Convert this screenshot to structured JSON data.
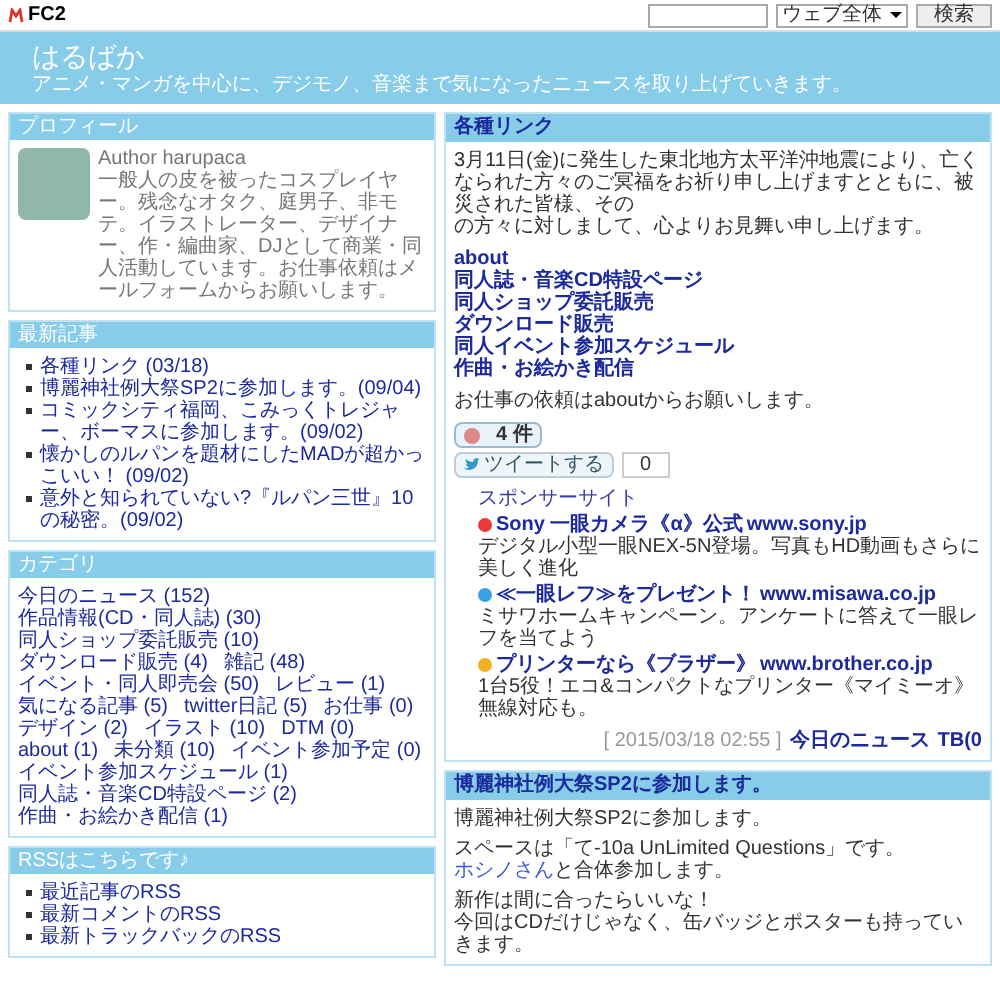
{
  "topbar": {
    "logo": "FC2",
    "search_scope": "ウェブ全体",
    "search_button": "検索"
  },
  "header": {
    "title": "はるばか",
    "tagline": "アニメ・マンガを中心に、デジモノ、音楽まで気になったニュースを取り上げていきます。"
  },
  "sidebar": {
    "profile": {
      "title": "プロフィール",
      "author": "Author harupaca",
      "bio": "一般人の皮を被ったコスプレイヤー。残念なオタク、庭男子、非モテ。イラストレーター、デザイナー、作・編曲家、DJとして商業・同人活動しています。お仕事依頼はメールフォームからお願いします。"
    },
    "latest": {
      "title": "最新記事",
      "items": [
        "各種リンク (03/18)",
        "博麗神社例大祭SP2に参加します。(09/04)",
        "コミックシティ福岡、こみっくトレジャー、ボーマスに参加します。(09/02)",
        "懐かしのルパンを題材にしたMADが超かっこいい！ (09/02)",
        "意外と知られていない?『ルパン三世』10の秘密。(09/02)"
      ]
    },
    "categories": {
      "title": "カテゴリ",
      "items": [
        "今日のニュース (152)",
        "作品情報(CD・同人誌) (30)",
        "同人ショップ委託販売 (10)",
        "ダウンロード販売 (4)",
        "雑記 (48)",
        "イベント・同人即売会 (50)",
        "レビュー (1)",
        "気になる記事 (5)",
        "twitter日記 (5)",
        "お仕事 (0)",
        "デザイン (2)",
        "イラスト (10)",
        "DTM (0)",
        "about (1)",
        "未分類 (10)",
        "イベント参加予定 (0)",
        "イベント参加スケジュール (1)",
        "同人誌・音楽CD特設ページ (2)",
        "作曲・お絵かき配信 (1)"
      ]
    },
    "rss": {
      "title": "RSSはこちらです♪",
      "items": [
        "最近記事のRSS",
        "最新コメントのRSS",
        "最新トラックバックのRSS"
      ]
    }
  },
  "links_entry": {
    "title": "各種リンク",
    "message_lines": [
      "3月11日(金)に発生した東北地方太平洋沖地震により、亡くなられた方々のご冥福をお祈り申し上げますとともに、被災された皆様、その",
      "の方々に対しまして、心よりお見舞い申し上げます。"
    ],
    "links": [
      "about",
      "同人誌・音楽CD特設ページ",
      "同人ショップ委託販売",
      "ダウンロード販売",
      "同人イベント参加スケジュール",
      "作曲・お絵かき配信"
    ],
    "note": "お仕事の依頼はaboutからお願いします。",
    "bookmark_count": "4 件",
    "tweet_label": "ツイートする",
    "tweet_count": "0",
    "sponsor": {
      "title": "スポンサーサイト",
      "ads": [
        {
          "title": "Sony 一眼カメラ《α》公式",
          "url": "www.sony.jp",
          "desc": "デジタル小型一眼NEX-5N登場。写真もHD動画もさらに美しく進化",
          "color": "#e83a3a"
        },
        {
          "title": "≪一眼レフ≫をプレゼント！",
          "url": "www.misawa.co.jp",
          "desc": "ミサワホームキャンペーン。アンケートに答えて一眼レフを当てよう",
          "color": "#3aa0e8"
        },
        {
          "title": "プリンターなら《ブラザー》",
          "url": "www.brother.co.jp",
          "desc": "1台5役！エコ&コンパクトなプリンター《マイミーオ》無線対応も。",
          "color": "#f0b020"
        }
      ]
    },
    "footer": {
      "date": "[ 2015/03/18 02:55 ]",
      "category": "今日のニュース",
      "trackback": "TB(0"
    }
  },
  "event_entry": {
    "title": "博麗神社例大祭SP2に参加します。",
    "paragraphs": [
      [
        {
          "kind": "text",
          "text": "博麗神社例大祭SP2に参加します。"
        }
      ],
      [
        {
          "kind": "text",
          "text": "スペースは「て-10a UnLimited Questions」です。"
        },
        {
          "kind": "link",
          "link": "ホシノさん",
          "text": "と合体参加します。"
        }
      ],
      [
        {
          "kind": "text",
          "text": "新作は間に合ったらいいな！"
        },
        {
          "kind": "text",
          "text": "今回はCDだけじゃなく、缶バッジとポスターも持っていきます。"
        }
      ]
    ]
  }
}
